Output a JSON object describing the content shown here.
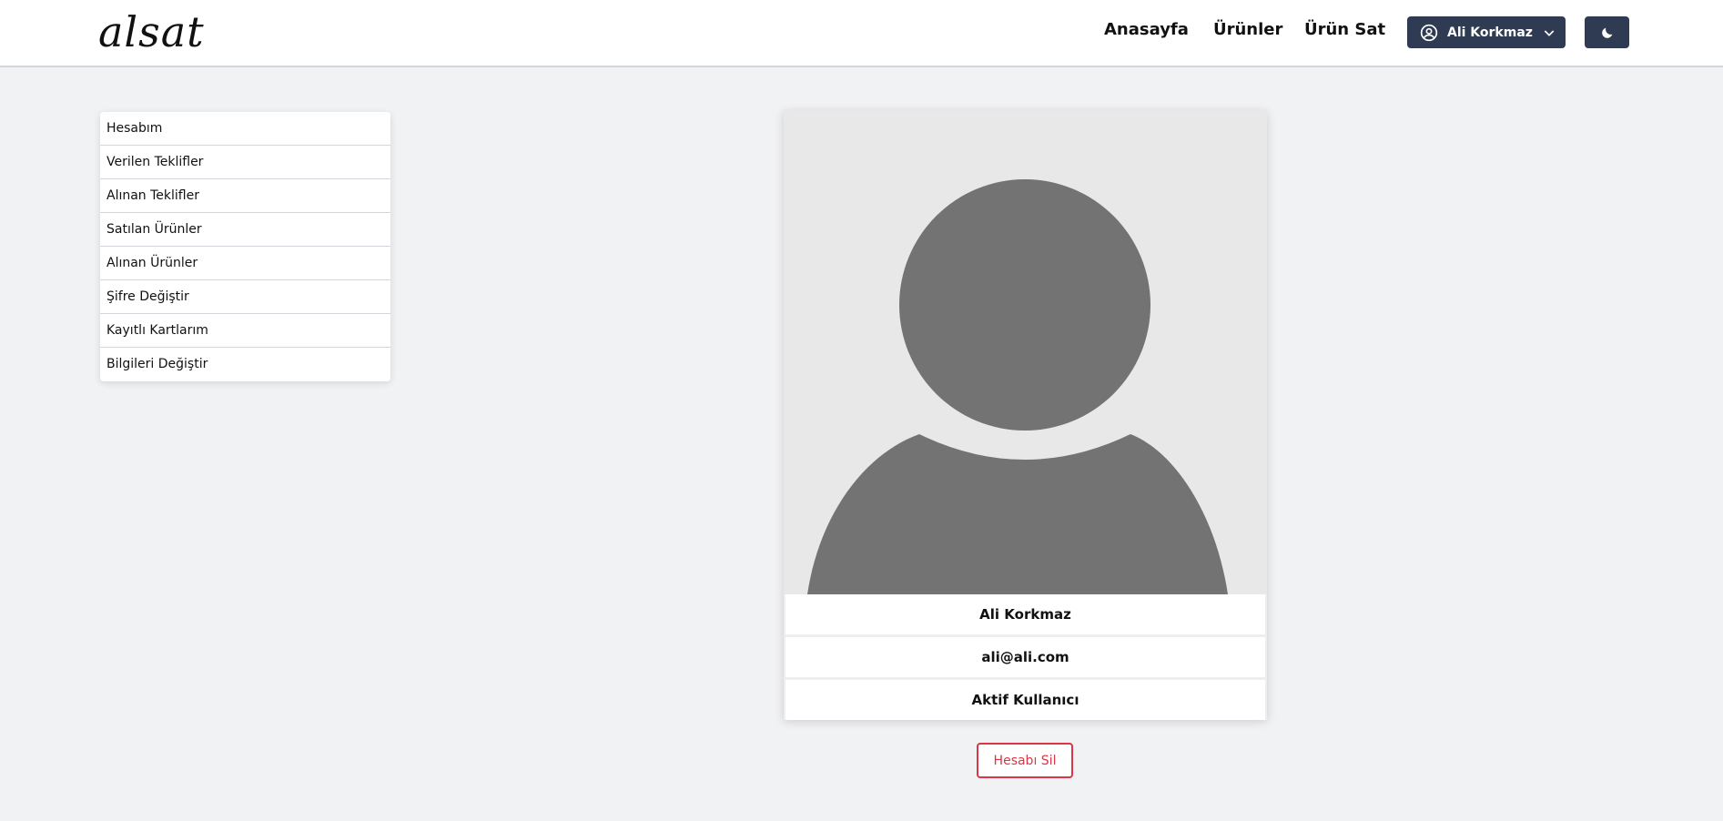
{
  "header": {
    "logo": "alsat",
    "nav": [
      {
        "label": "Anasayfa"
      },
      {
        "label": "Ürünler"
      },
      {
        "label": "Ürün Sat"
      }
    ],
    "user_menu": {
      "label": "Ali Korkmaz",
      "icon": "user-circle-icon",
      "chevron": "chevron-down-icon"
    },
    "theme_toggle": {
      "icon": "moon-icon"
    }
  },
  "sidebar": {
    "items": [
      {
        "label": "Hesabım"
      },
      {
        "label": "Verilen Teklifler"
      },
      {
        "label": "Alınan Teklifler"
      },
      {
        "label": "Satılan Ürünler"
      },
      {
        "label": "Alınan Ürünler"
      },
      {
        "label": "Şifre Değiştir"
      },
      {
        "label": "Kayıtlı Kartlarım"
      },
      {
        "label": "Bilgileri Değiştir"
      }
    ]
  },
  "profile": {
    "avatar": "user-placeholder-icon",
    "name": "Ali Korkmaz",
    "email": "ali@ali.com",
    "status": "Aktif Kullanıcı"
  },
  "actions": {
    "delete_account": "Hesabı Sil"
  },
  "colors": {
    "header_button": "#2f3b52",
    "danger": "#dc3545",
    "page_bg": "#f1f2f4",
    "avatar_fill": "#737373"
  }
}
